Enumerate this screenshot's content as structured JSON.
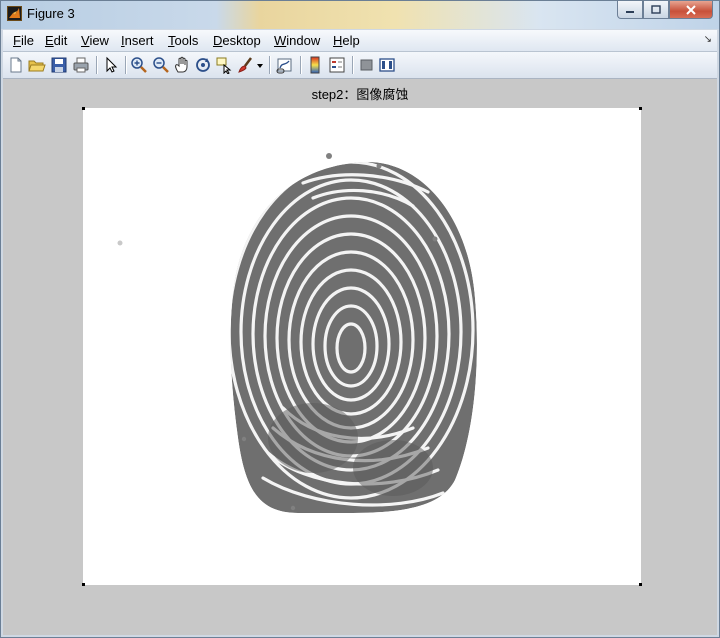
{
  "window": {
    "title": "Figure 3"
  },
  "menu": [
    "File",
    "Edit",
    "View",
    "Insert",
    "Tools",
    "Desktop",
    "Window",
    "Help"
  ],
  "menu_underline": [
    "F",
    "E",
    "V",
    "I",
    "T",
    "D",
    "W",
    "H"
  ],
  "toolbar": [
    "new-figure-icon",
    "open-file-icon",
    "save-icon",
    "print-icon",
    "edit-plot-arrow-icon",
    "zoom-in-icon",
    "zoom-out-icon",
    "pan-hand-icon",
    "rotate-3d-icon",
    "data-cursor-icon",
    "brush-icon",
    "brush-dropdown-icon",
    "link-plot-icon",
    "colorbar-icon",
    "legend-icon",
    "hide-plot-tools-icon",
    "show-plot-tools-icon"
  ],
  "figure": {
    "title": "step2：图像腐蚀"
  }
}
